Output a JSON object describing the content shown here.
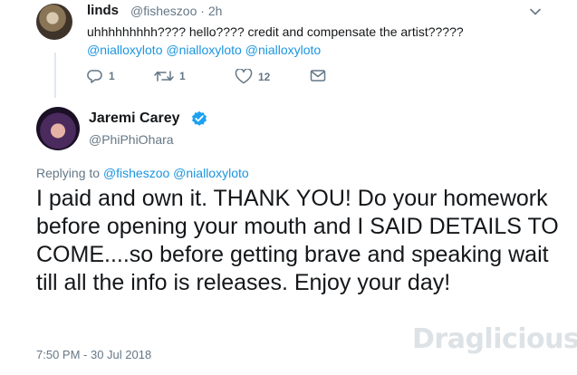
{
  "reply_tweet": {
    "author_name": "linds",
    "handle": "@fisheszoo",
    "separator": "·",
    "age": "2h",
    "text": "uhhhhhhhhh???? hello???? credit and compensate the artist?????",
    "mentions": "@nialloxyloto @nialloxyloto @nialloxyloto",
    "actions": {
      "reply_count": "1",
      "retweet_count": "1",
      "like_count": "12"
    }
  },
  "main_tweet": {
    "author_name": "Jaremi Carey",
    "handle": "@PhiPhiOhara",
    "replying_prefix": "Replying to",
    "replying_to": "@fisheszoo @nialloxyloto",
    "text": "I paid and own it. THANK YOU! Do your homework before opening your mouth and I SAID DETAILS TO COME....so before getting brave and speaking wait till all the info is releases. Enjoy your day!",
    "timestamp": "7:50 PM - 30 Jul 2018"
  },
  "watermark": "Draglicious",
  "colors": {
    "link": "#1b95e0",
    "secondary_text": "#657786",
    "verified": "#1da1f2"
  },
  "icons": [
    "reply-icon",
    "retweet-icon",
    "like-icon",
    "dm-icon",
    "chevron-down-icon",
    "verified-badge-icon"
  ]
}
